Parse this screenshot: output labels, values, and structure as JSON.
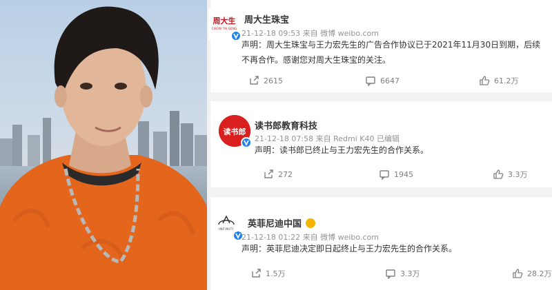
{
  "posts": [
    {
      "account": "周大生珠宝",
      "avatar_text": "周大生",
      "avatar_subtext": "CHOW TAI SENG",
      "meta": "21-12-18 09:53 来自 微博 weibo.com",
      "text": "声明：周大生珠宝与王力宏先生的广告合作协议已于2021年11月30日到期，后续不再合作。感谢您对周大生珠宝的关注。",
      "reposts": "2615",
      "comments": "6647",
      "likes": "61.2万"
    },
    {
      "account": "读书郎教育科技",
      "avatar_text": "读书郎",
      "meta": "21-12-18 07:58 来自 Redmi K40 已编辑",
      "text": "声明：读书郎已终止与王力宏先生的合作关系。",
      "reposts": "272",
      "comments": "1945",
      "likes": "3.3万"
    },
    {
      "account": "英菲尼迪中国",
      "avatar_text": "INFINITI",
      "meta": "21-12-18 01:22 来自 微博 weibo.com",
      "text": "声明：英菲尼迪决定即日起终止与王力宏先生的合作关系。",
      "reposts": "1.5万",
      "comments": "3.3万",
      "likes": "28.2万"
    }
  ],
  "colors": {
    "verified_badge": "#1e82e8",
    "dushulang_red": "#d9201f",
    "chowtaiseng_red": "#c8161d",
    "sweater_orange": "#e4661d"
  },
  "icons": [
    "repost-icon",
    "comment-icon",
    "like-icon",
    "verified-icon"
  ]
}
